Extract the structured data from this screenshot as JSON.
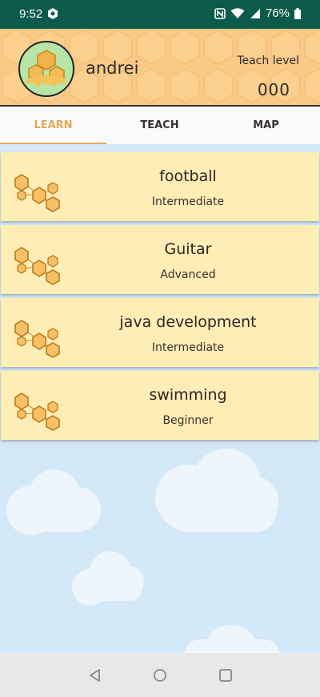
{
  "status_bar": {
    "time": "9:52",
    "battery": "76%"
  },
  "header": {
    "username": "andrei",
    "teach_level_label": "Teach level",
    "teach_level_value": "000"
  },
  "tabs": [
    {
      "label": "LEARN",
      "active": true
    },
    {
      "label": "TEACH",
      "active": false
    },
    {
      "label": "MAP",
      "active": false
    }
  ],
  "skills": [
    {
      "title": "football",
      "level": "Intermediate"
    },
    {
      "title": "Guitar",
      "level": "Advanced"
    },
    {
      "title": "java development",
      "level": "Intermediate"
    },
    {
      "title": "swimming",
      "level": "Beginner"
    }
  ],
  "colors": {
    "status_bar": "#0c5a4a",
    "header": "#f9c987",
    "card": "#feedb5",
    "accent": "#e3a85a",
    "sky": "#d4e9f7"
  }
}
